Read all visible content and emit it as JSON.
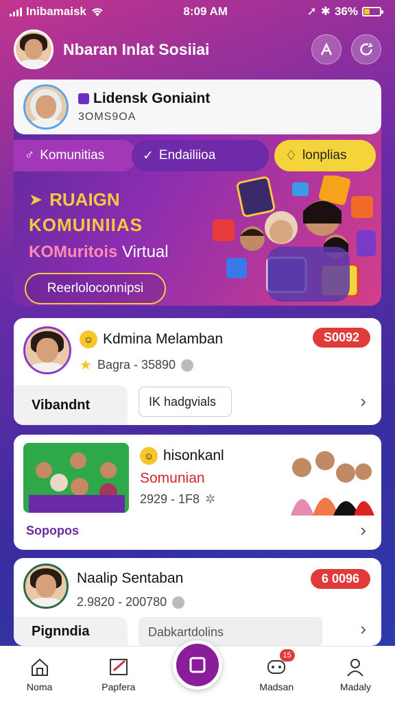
{
  "status_bar": {
    "carrier": "Inibamaisk",
    "time": "8:09 AM",
    "battery_percent": "36%",
    "battery_level": 0.36
  },
  "header": {
    "title": "Nbaran Inlat Sosiiai"
  },
  "hero": {
    "name": "Lidensk Goniaint",
    "code": "3OMS9OA",
    "tabs": [
      {
        "label": "Komunitias"
      },
      {
        "label": "Endailiioa"
      },
      {
        "label": "lonplias"
      }
    ],
    "headline1": "RUAIGN",
    "headline2": "KOMUINIIAS",
    "headline3_a": "KOMuritois",
    "headline3_b": " Virtual",
    "button_label": "Reerloloconnipsi"
  },
  "cards": [
    {
      "title": "Kdmina Melamban",
      "badge": "S0092",
      "meta": "Bagra - 35890",
      "footer_label": "Vibandnt",
      "chip": "IK hadgvials"
    },
    {
      "title": "hisonkanl",
      "subtitle": "Somunian",
      "meta": "2929 - 1F8",
      "footer_label": "Sopopos"
    },
    {
      "title": "Naalip Sentaban",
      "badge": "6 0096",
      "meta": "2.9820 - 200780",
      "footer_label": "Pignndia",
      "chip": "Dabkartdolins"
    }
  ],
  "bottom_nav": {
    "items": [
      {
        "label": "Noma",
        "icon": "home-icon"
      },
      {
        "label": "Papfera",
        "icon": "edit-icon"
      },
      {
        "label": "",
        "icon": "square-icon"
      },
      {
        "label": "Madsan",
        "icon": "chat-icon",
        "badge": "15"
      },
      {
        "label": "Madaly",
        "icon": "profile-icon"
      }
    ]
  },
  "colors": {
    "brand_purple": "#8a1d9a",
    "accent_yellow": "#f5c842",
    "badge_red": "#e13a3a"
  }
}
